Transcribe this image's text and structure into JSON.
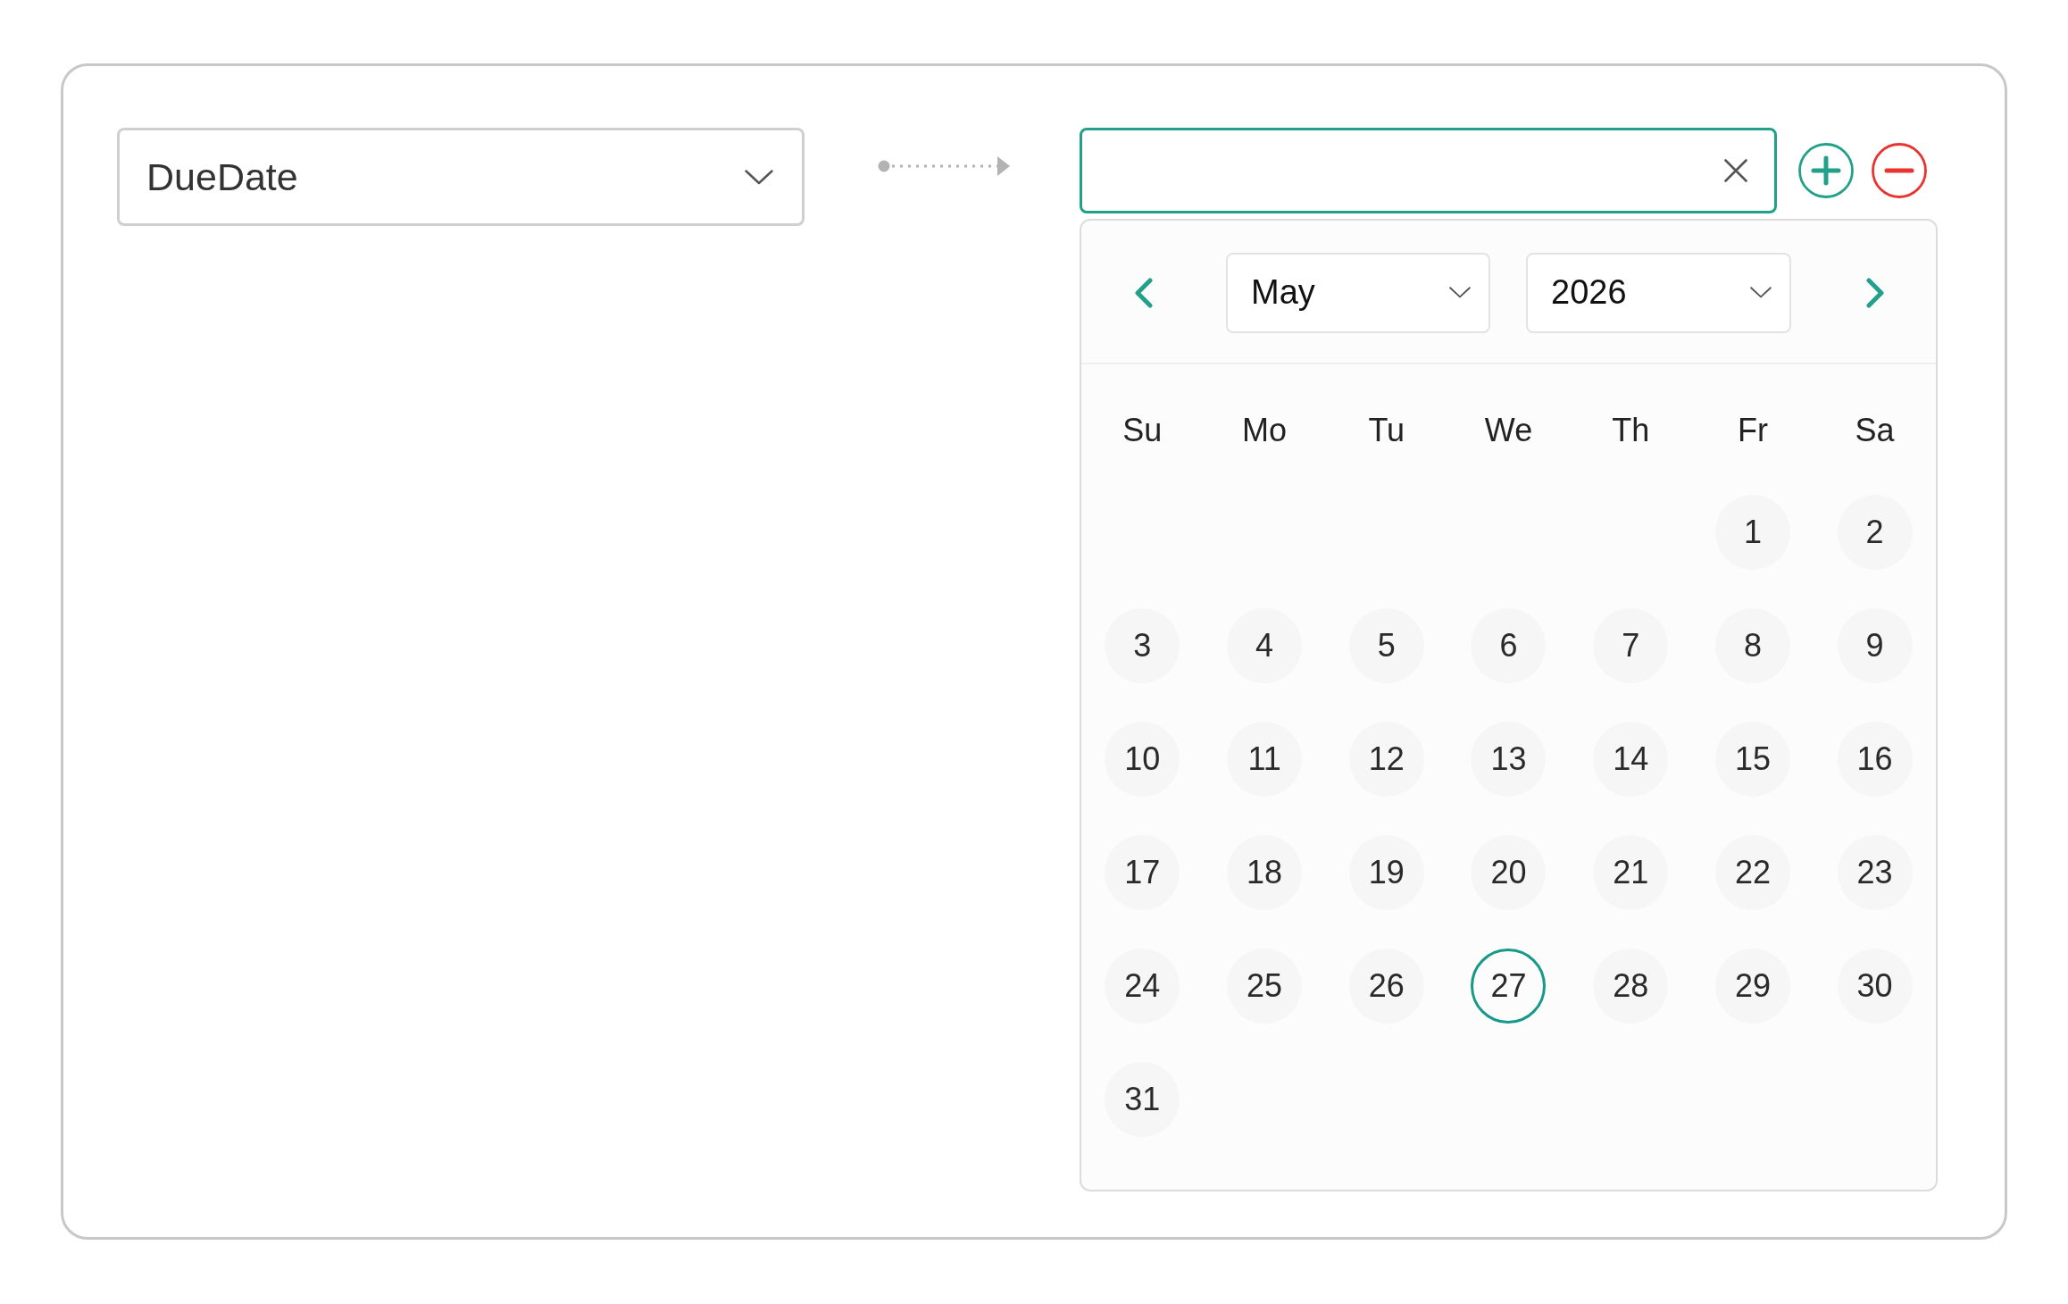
{
  "filter_row": {
    "field_select": {
      "value": "DueDate"
    },
    "date_input": {
      "focused": true
    }
  },
  "calendar": {
    "month": "May",
    "year": "2026",
    "weekdays": [
      "Su",
      "Mo",
      "Tu",
      "We",
      "Th",
      "Fr",
      "Sa"
    ],
    "weeks": [
      [
        {
          "label": "1",
          "today": false
        },
        {
          "label": "2",
          "today": false
        }
      ],
      [
        {
          "label": "3",
          "today": false
        },
        {
          "label": "4",
          "today": false
        },
        {
          "label": "5",
          "today": false
        },
        {
          "label": "6",
          "today": false
        },
        {
          "label": "7",
          "today": false
        },
        {
          "label": "8",
          "today": false
        },
        {
          "label": "9",
          "today": false
        }
      ],
      [
        {
          "label": "10",
          "today": false
        },
        {
          "label": "11",
          "today": false
        },
        {
          "label": "12",
          "today": false
        },
        {
          "label": "13",
          "today": false
        },
        {
          "label": "14",
          "today": false
        },
        {
          "label": "15",
          "today": false
        },
        {
          "label": "16",
          "today": false
        }
      ],
      [
        {
          "label": "17",
          "today": false
        },
        {
          "label": "18",
          "today": false
        },
        {
          "label": "19",
          "today": false
        },
        {
          "label": "20",
          "today": false
        },
        {
          "label": "21",
          "today": false
        },
        {
          "label": "22",
          "today": false
        },
        {
          "label": "23",
          "today": false
        }
      ],
      [
        {
          "label": "24",
          "today": false
        },
        {
          "label": "25",
          "today": false
        },
        {
          "label": "26",
          "today": false
        },
        {
          "label": "27",
          "today": true
        },
        {
          "label": "28",
          "today": false
        },
        {
          "label": "29",
          "today": false
        },
        {
          "label": "30",
          "today": false
        }
      ],
      [
        {
          "label": "31",
          "today": false
        }
      ]
    ]
  }
}
